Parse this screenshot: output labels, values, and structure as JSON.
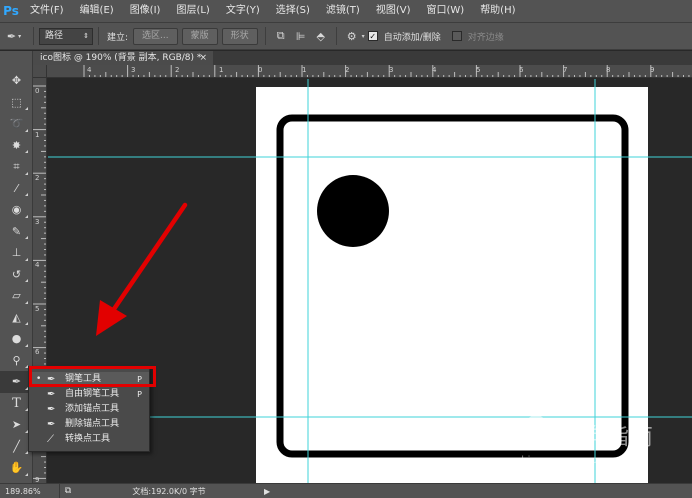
{
  "app": {
    "logo": "Ps",
    "menus": [
      "文件(F)",
      "编辑(E)",
      "图像(I)",
      "图层(L)",
      "文字(Y)",
      "选择(S)",
      "滤镜(T)",
      "视图(V)",
      "窗口(W)",
      "帮助(H)"
    ]
  },
  "options_bar": {
    "tool_icon": "pen-icon",
    "mode_value": "路径",
    "build_label": "建立:",
    "selection_button": "选区...",
    "mask_button": "蒙版",
    "shape_button": "形状",
    "auto_add_delete_label": "自动添加/删除",
    "auto_add_delete_checked": true,
    "align_edges_label": "对齐边缘",
    "align_edges_checked": false
  },
  "document": {
    "tab_title": "ico图标 @ 190% (背景 副本, RGB/8) *",
    "tab_close": "×"
  },
  "rulers": {
    "top_labels": [
      "4",
      "3",
      "2",
      "1",
      "0",
      "1",
      "2",
      "3",
      "4",
      "5",
      "6",
      "7",
      "8",
      "9"
    ],
    "left_labels": [
      "0",
      "1",
      "2",
      "3",
      "4",
      "5",
      "6",
      "7",
      "8",
      "9"
    ]
  },
  "flyout": {
    "items": [
      {
        "label": "钢笔工具",
        "key": "P",
        "icon": "pen-icon",
        "selected": true
      },
      {
        "label": "自由钢笔工具",
        "key": "P",
        "icon": "freeform-pen-icon",
        "selected": false
      },
      {
        "label": "添加锚点工具",
        "key": "",
        "icon": "add-anchor-icon",
        "selected": false
      },
      {
        "label": "删除锚点工具",
        "key": "",
        "icon": "delete-anchor-icon",
        "selected": false
      },
      {
        "label": "转换点工具",
        "key": "",
        "icon": "convert-point-icon",
        "selected": false
      }
    ],
    "bullet": "•"
  },
  "status": {
    "zoom": "189.86%",
    "doc_info": "文档:192.0K/0 字节",
    "arrow": "▶"
  },
  "annotation": {
    "arrow_color": "#e20000",
    "highlight_color": "#e20000"
  },
  "watermark": {
    "brand": "搜狗指南",
    "url": "zhinan.sogou.com"
  },
  "colors": {
    "guide": "#3fd3d8",
    "canvas_bg": "#282828",
    "panel_bg": "#535353",
    "document_bg": "#ffffff",
    "artwork": "#000000"
  }
}
